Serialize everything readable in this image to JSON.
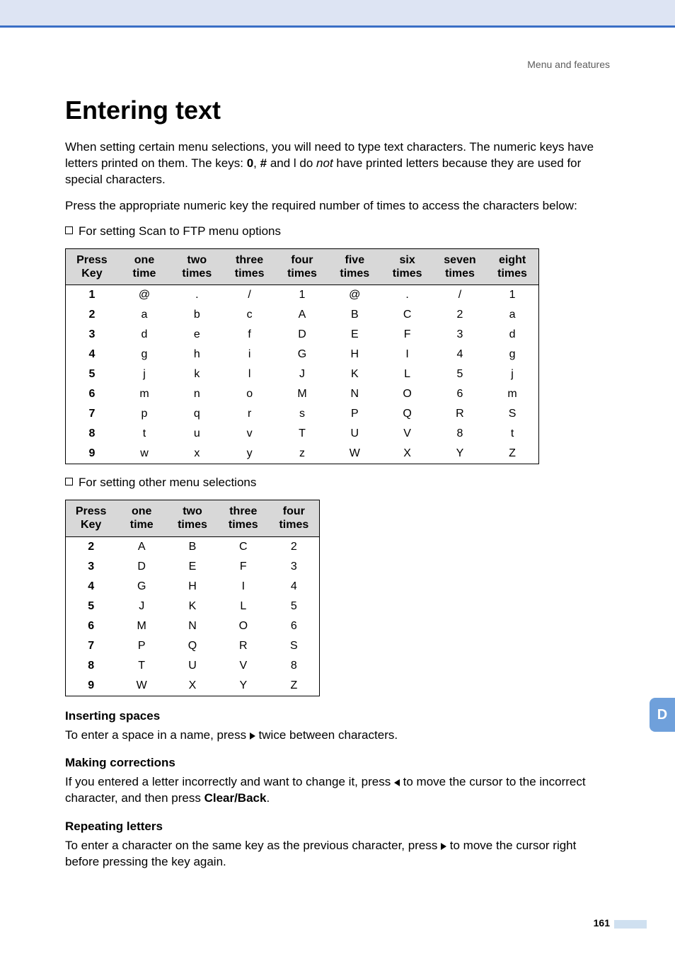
{
  "breadcrumb": "Menu and features",
  "title": "Entering text",
  "intro1_a": "When setting certain menu selections, you will need to type text characters. The numeric keys have letters printed on them. The keys: ",
  "intro1_b": " and ",
  "intro1_c": " do ",
  "intro1_d": " have printed letters because they are used for special characters.",
  "intro_bold_0": "0",
  "intro_bold_hash": "#",
  "intro_star": "l",
  "intro_not": "not",
  "intro2": "Press the appropriate numeric key the required number of times to access the characters below:",
  "bullet1": "For setting Scan to FTP menu options",
  "bullet2": "For setting other menu selections",
  "headers_ftp": [
    "Press Key",
    "one time",
    "two times",
    "three times",
    "four times",
    "five times",
    "six times",
    "seven times",
    "eight times"
  ],
  "ftp_rows": [
    [
      "1",
      "@",
      ".",
      "/",
      "1",
      "@",
      ".",
      "/",
      "1"
    ],
    [
      "2",
      "a",
      "b",
      "c",
      "A",
      "B",
      "C",
      "2",
      "a"
    ],
    [
      "3",
      "d",
      "e",
      "f",
      "D",
      "E",
      "F",
      "3",
      "d"
    ],
    [
      "4",
      "g",
      "h",
      "i",
      "G",
      "H",
      "I",
      "4",
      "g"
    ],
    [
      "5",
      "j",
      "k",
      "l",
      "J",
      "K",
      "L",
      "5",
      "j"
    ],
    [
      "6",
      "m",
      "n",
      "o",
      "M",
      "N",
      "O",
      "6",
      "m"
    ],
    [
      "7",
      "p",
      "q",
      "r",
      "s",
      "P",
      "Q",
      "R",
      "S"
    ],
    [
      "8",
      "t",
      "u",
      "v",
      "T",
      "U",
      "V",
      "8",
      "t"
    ],
    [
      "9",
      "w",
      "x",
      "y",
      "z",
      "W",
      "X",
      "Y",
      "Z"
    ]
  ],
  "headers_other": [
    "Press Key",
    "one time",
    "two times",
    "three times",
    "four times"
  ],
  "other_rows": [
    [
      "2",
      "A",
      "B",
      "C",
      "2"
    ],
    [
      "3",
      "D",
      "E",
      "F",
      "3"
    ],
    [
      "4",
      "G",
      "H",
      "I",
      "4"
    ],
    [
      "5",
      "J",
      "K",
      "L",
      "5"
    ],
    [
      "6",
      "M",
      "N",
      "O",
      "6"
    ],
    [
      "7",
      "P",
      "Q",
      "R",
      "S"
    ],
    [
      "8",
      "T",
      "U",
      "V",
      "8"
    ],
    [
      "9",
      "W",
      "X",
      "Y",
      "Z"
    ]
  ],
  "h_spaces": "Inserting spaces",
  "p_spaces_a": "To enter a space in a name, press ",
  "p_spaces_b": " twice between characters.",
  "h_corr": "Making corrections",
  "p_corr_a": "If you entered a letter incorrectly and want to change it, press ",
  "p_corr_b": " to move the cursor to the incorrect character, and then press ",
  "p_corr_bold": "Clear/Back",
  "p_corr_c": ".",
  "h_rep": "Repeating letters",
  "p_rep_a": "To enter a character on the same key as the previous character, press ",
  "p_rep_b": " to move the cursor right before pressing the key again.",
  "side_tab": "D",
  "page_num": "161"
}
